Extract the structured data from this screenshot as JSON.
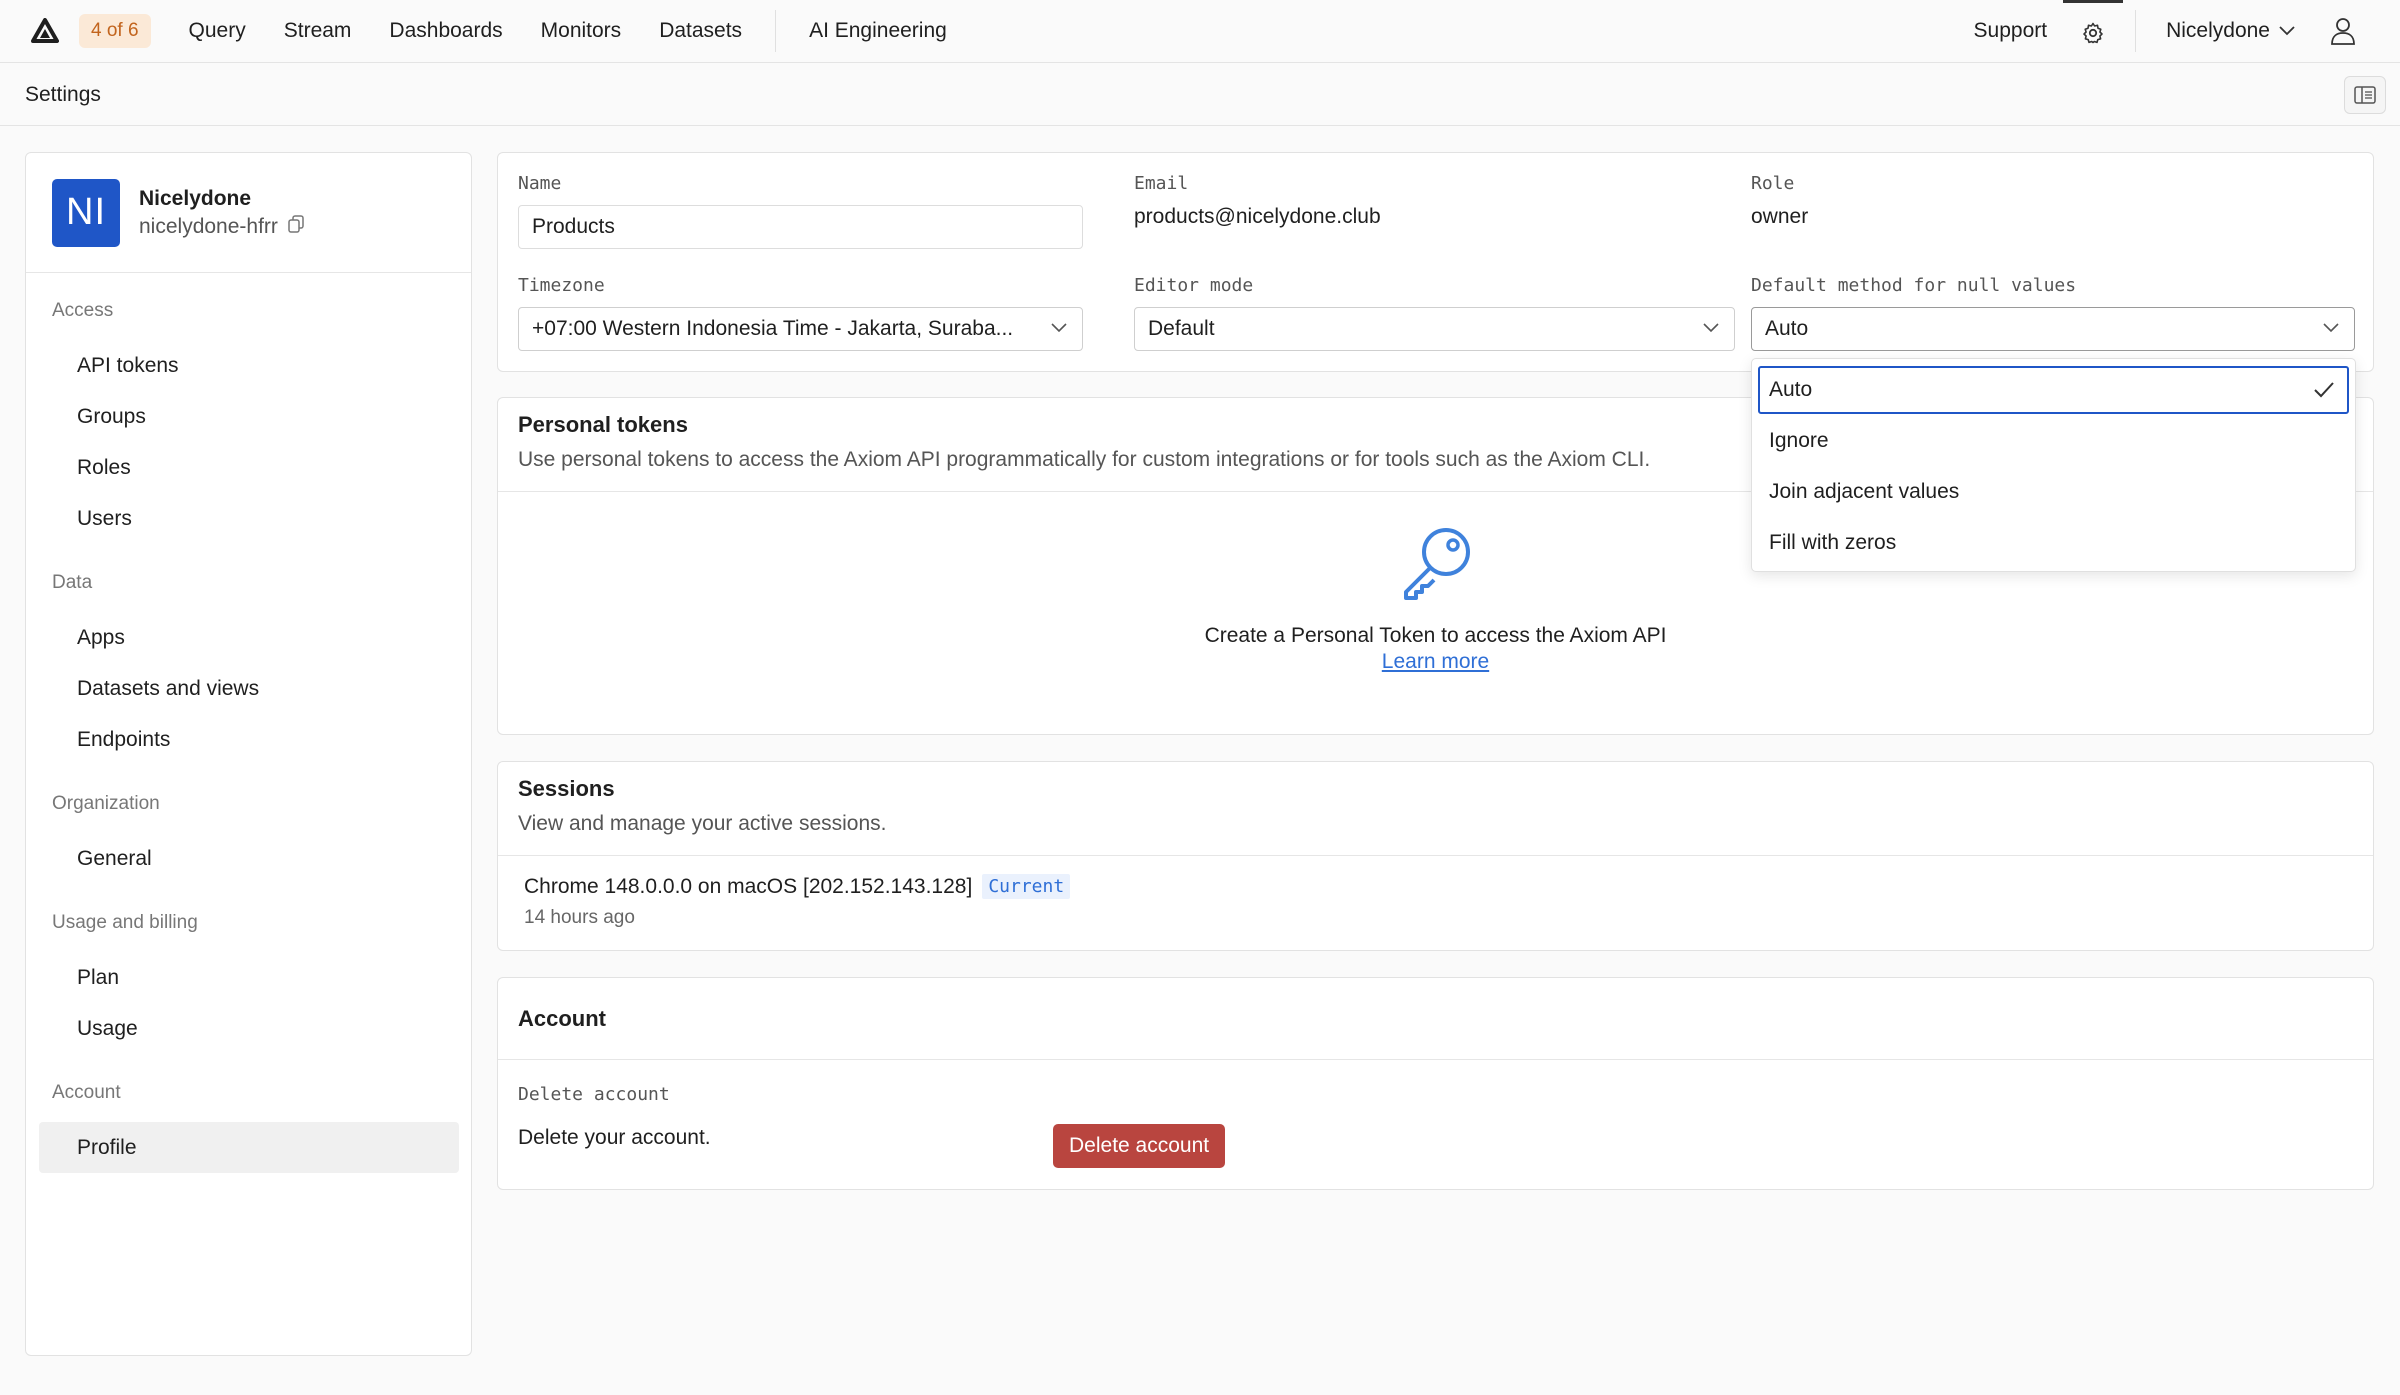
{
  "topnav": {
    "count_badge": "4 of 6",
    "items": [
      "Query",
      "Stream",
      "Dashboards",
      "Monitors",
      "Datasets"
    ],
    "ai_item": "AI Engineering",
    "support": "Support",
    "org_menu": "Nicelydone"
  },
  "subheader": {
    "title": "Settings"
  },
  "sidebar": {
    "org_initials": "NI",
    "org_name": "Nicelydone",
    "org_id": "nicelydone-hfrr",
    "groups": [
      {
        "heading": "Access",
        "items": [
          "API tokens",
          "Groups",
          "Roles",
          "Users"
        ]
      },
      {
        "heading": "Data",
        "items": [
          "Apps",
          "Datasets and views",
          "Endpoints"
        ]
      },
      {
        "heading": "Organization",
        "items": [
          "General"
        ]
      },
      {
        "heading": "Usage and billing",
        "items": [
          "Plan",
          "Usage"
        ]
      },
      {
        "heading": "Account",
        "items": [
          "Profile"
        ]
      }
    ]
  },
  "profile": {
    "name_label": "Name",
    "name_value": "Products",
    "email_label": "Email",
    "email_value": "products@nicelydone.club",
    "role_label": "Role",
    "role_value": "owner",
    "timezone_label": "Timezone",
    "timezone_value": "+07:00 Western Indonesia Time - Jakarta, Suraba...",
    "editor_label": "Editor mode",
    "editor_value": "Default",
    "null_label": "Default method for null values",
    "null_value": "Auto"
  },
  "null_dropdown": {
    "options": [
      "Auto",
      "Ignore",
      "Join adjacent values",
      "Fill with zeros"
    ],
    "selected": "Auto"
  },
  "tokens": {
    "title": "Personal tokens",
    "description": "Use personal tokens to access the Axiom API programmatically for custom integrations or for tools such as the Axiom CLI.",
    "empty_text": "Create a Personal Token to access the Axiom API",
    "learn_more": "Learn more"
  },
  "sessions": {
    "title": "Sessions",
    "description": "View and manage your active sessions.",
    "items": [
      {
        "device": "Chrome 148.0.0.0 on macOS [202.152.143.128]",
        "badge": "Current",
        "time": "14 hours ago"
      }
    ]
  },
  "account": {
    "title": "Account",
    "delete_label": "Delete account",
    "delete_desc": "Delete your account.",
    "delete_button": "Delete account"
  },
  "colors": {
    "accent": "#1f56c7",
    "danger": "#b9453f",
    "badge_bg": "#fbe9d7",
    "badge_text": "#c2641d",
    "current_text": "#2f6fd6"
  }
}
